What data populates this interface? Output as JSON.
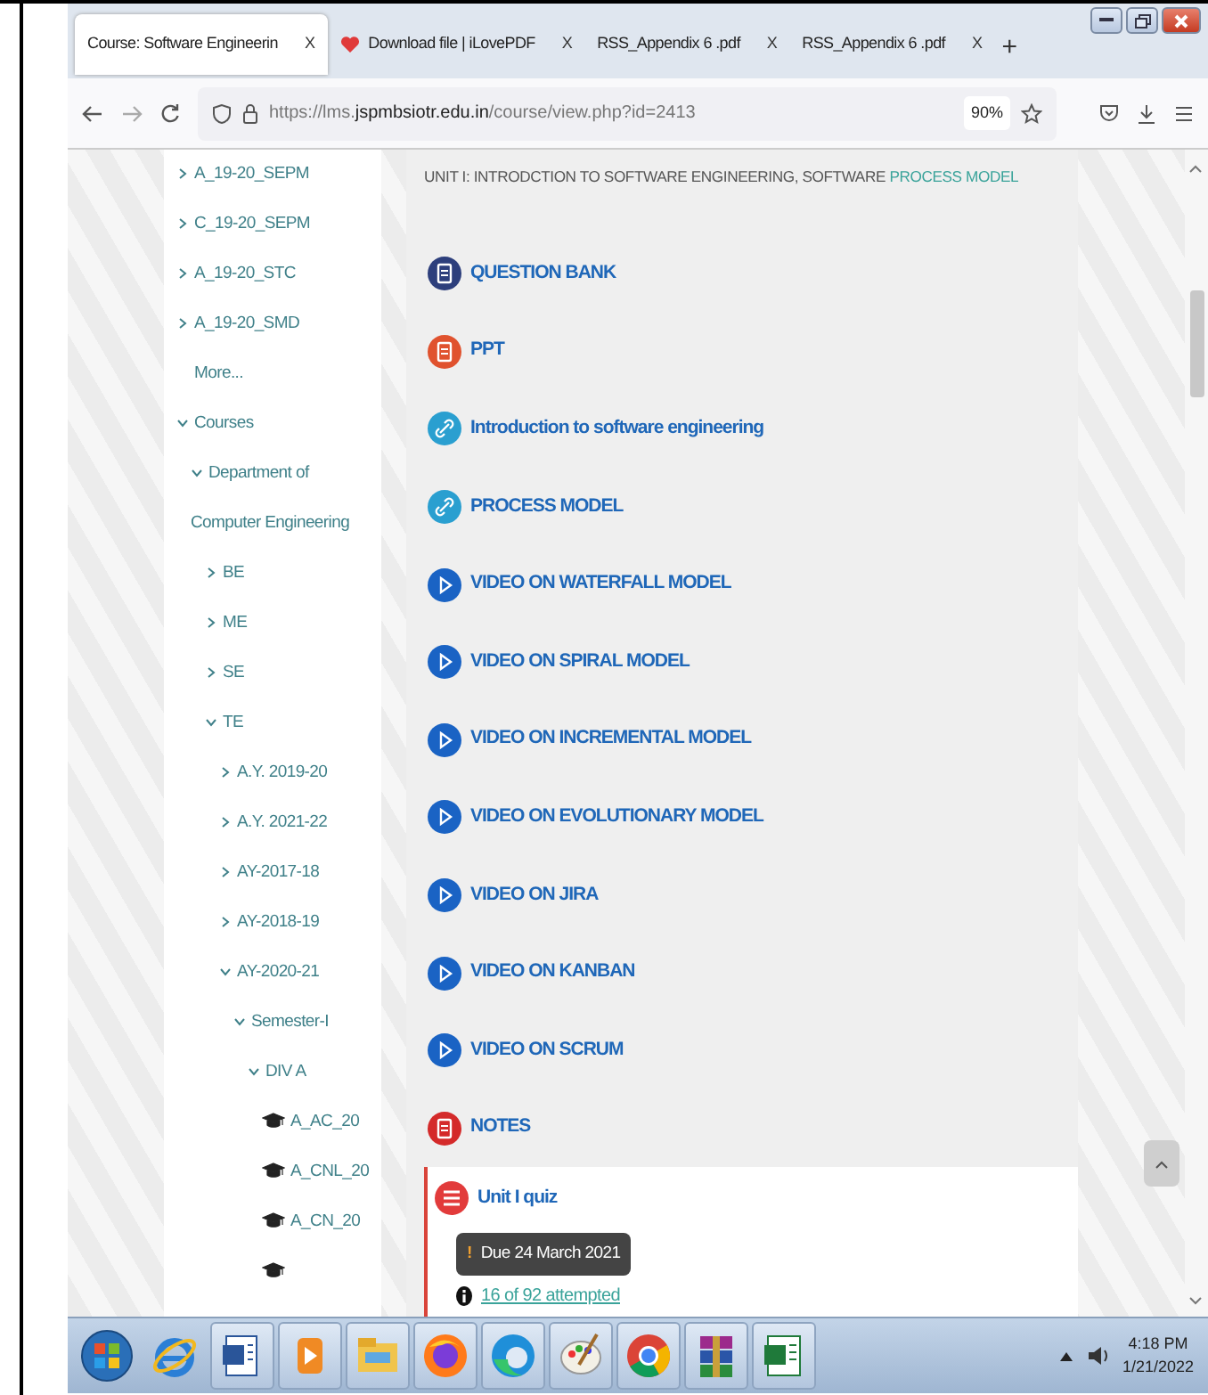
{
  "browser": {
    "tabs": [
      {
        "title": "Course: Software Engineerin",
        "close": "X",
        "selected": true,
        "kind": "plain"
      },
      {
        "title": "Download file | iLovePDF",
        "close": "X",
        "selected": false,
        "kind": "heart"
      },
      {
        "title": "RSS_Appendix 6 .pdf",
        "close": "X",
        "selected": false,
        "kind": "plain"
      },
      {
        "title": "RSS_Appendix 6 .pdf",
        "close": "X",
        "selected": false,
        "kind": "plain"
      }
    ],
    "new_tab": "+",
    "url": "https://lms.**jspmbsiotr.edu.in**/course/view.php?id=2413",
    "zoom": "90%"
  },
  "sidebar": {
    "items": [
      {
        "kind": "folder",
        "label": "A_19-20_SEPM",
        "expanded": false
      },
      {
        "kind": "folder",
        "label": "C_19-20_SEPM",
        "expanded": false
      },
      {
        "kind": "folder",
        "label": "A_19-20_STC",
        "expanded": false
      },
      {
        "kind": "folder",
        "label": "A_19-20_SMD",
        "expanded": false
      },
      {
        "kind": "link",
        "label": "More..."
      },
      {
        "kind": "folder",
        "label": "Courses",
        "expanded": true,
        "children": [
          {
            "kind": "folder",
            "label": "Department of Computer Engineering",
            "expanded": true,
            "children": [
              {
                "kind": "folder",
                "label": "BE",
                "expanded": false
              },
              {
                "kind": "folder",
                "label": "ME",
                "expanded": false
              },
              {
                "kind": "folder",
                "label": "SE",
                "expanded": false
              },
              {
                "kind": "folder",
                "label": "TE",
                "expanded": true,
                "children": [
                  {
                    "kind": "folder",
                    "label": "A.Y. 2019-20",
                    "expanded": false
                  },
                  {
                    "kind": "folder",
                    "label": "A.Y. 2021-22",
                    "expanded": false
                  },
                  {
                    "kind": "folder",
                    "label": "AY-2017-18",
                    "expanded": false
                  },
                  {
                    "kind": "folder",
                    "label": "AY-2018-19",
                    "expanded": false
                  },
                  {
                    "kind": "folder",
                    "label": "AY-2020-21",
                    "expanded": true,
                    "children": [
                      {
                        "kind": "folder",
                        "label": "Semester-I",
                        "expanded": true,
                        "children": [
                          {
                            "kind": "folder",
                            "label": "DIV A",
                            "expanded": true,
                            "children": [
                              {
                                "kind": "course",
                                "label": "A_AC_20"
                              },
                              {
                                "kind": "course",
                                "label": "A_CNL_20"
                              },
                              {
                                "kind": "course",
                                "label": "A_CN_20"
                              },
                              {
                                "kind": "course"
                              }
                            ]
                          }
                        ]
                      }
                    ]
                  }
                ]
              }
            ]
          }
        ]
      }
    ]
  },
  "course": {
    "heading": "UNIT I: INTRODCTION TO SOFTWARE ENGINEERING, SOFTWARE ",
    "heading_highlight": "PROCESS MODEL",
    "activities": [
      {
        "kind": "file",
        "label": "QUESTION BANK",
        "color": "#2d3f7c"
      },
      {
        "kind": "file",
        "label": "PPT",
        "color": "#e0522e"
      },
      {
        "kind": "url",
        "label": "Introduction to software engineering",
        "color": "#2a9fd0"
      },
      {
        "kind": "url",
        "label": "PROCESS MODEL",
        "color": "#2a9fd0"
      },
      {
        "kind": "video",
        "label": "VIDEO ON WATERFALL MODEL",
        "color": "#1a63c4"
      },
      {
        "kind": "video",
        "label": "VIDEO ON SPIRAL MODEL",
        "color": "#1a63c4"
      },
      {
        "kind": "video",
        "label": "VIDEO ON INCREMENTAL MODEL",
        "color": "#1a63c4"
      },
      {
        "kind": "video",
        "label": "VIDEO ON EVOLUTIONARY MODEL",
        "color": "#1a63c4"
      },
      {
        "kind": "video",
        "label": "VIDEO ON JIRA",
        "color": "#1a63c4"
      },
      {
        "kind": "video",
        "label": "VIDEO ON KANBAN",
        "color": "#1a63c4"
      },
      {
        "kind": "video",
        "label": "VIDEO ON SCRUM",
        "color": "#1a63c4"
      },
      {
        "kind": "file",
        "label": "NOTES",
        "color": "#d42a2a"
      }
    ],
    "quiz": {
      "title": "Unit I quiz",
      "due_mark": "!",
      "due": "Due 24 March 2021",
      "attempts": "16 of 92 attempted"
    }
  },
  "taskbar": {
    "apps": [
      {
        "kind": "start",
        "running": false
      },
      {
        "kind": "ie",
        "running": false
      },
      {
        "kind": "word",
        "running": true
      },
      {
        "kind": "media",
        "running": true
      },
      {
        "kind": "folder",
        "running": true
      },
      {
        "kind": "firefox",
        "running": true
      },
      {
        "kind": "edge",
        "running": true
      },
      {
        "kind": "paint",
        "running": true
      },
      {
        "kind": "chrome",
        "running": true
      },
      {
        "kind": "archive",
        "running": true
      },
      {
        "kind": "sheet",
        "running": true
      }
    ],
    "time": "4:18 PM",
    "date": "1/21/2022"
  }
}
